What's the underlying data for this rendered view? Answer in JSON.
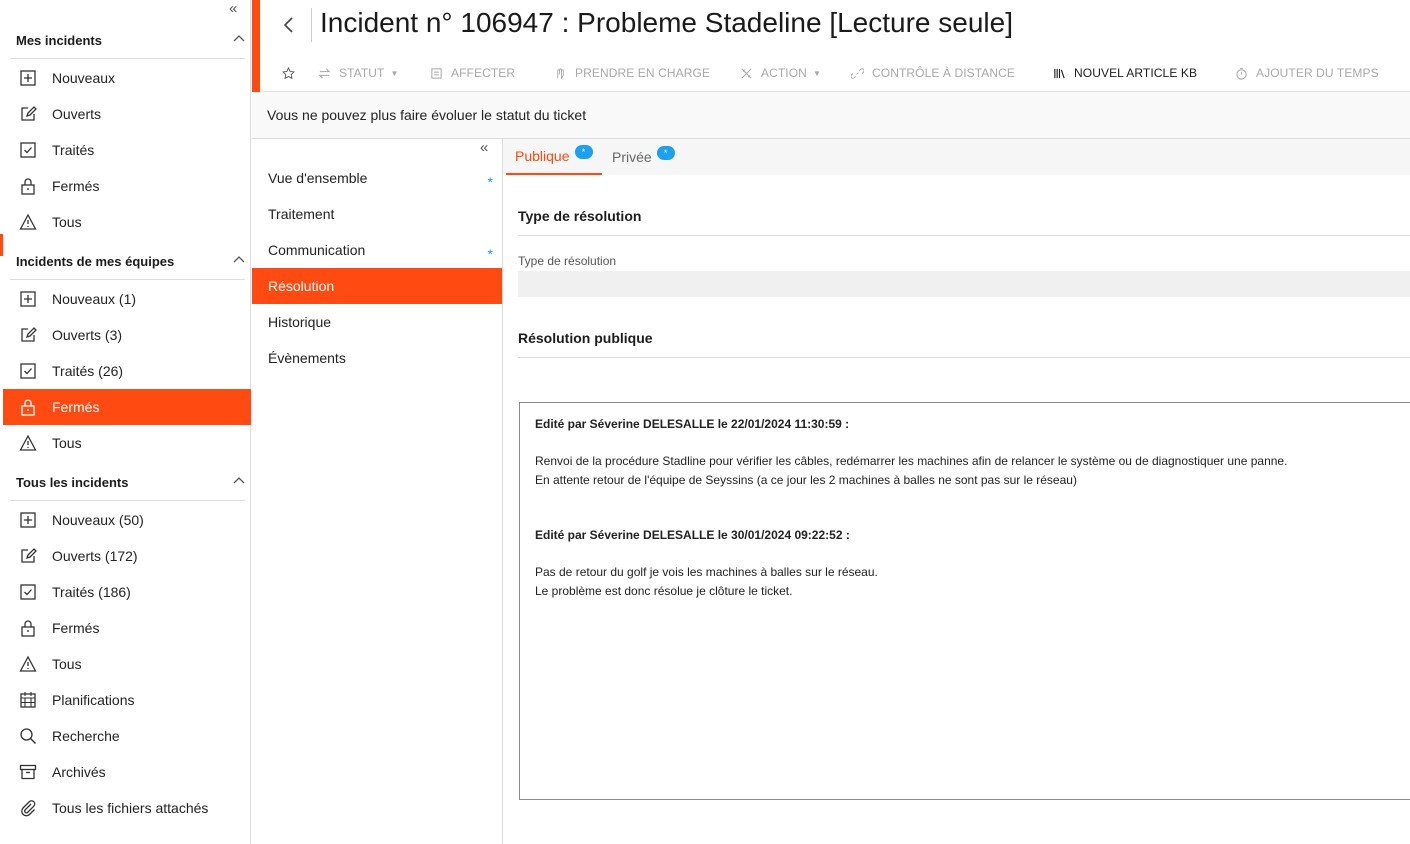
{
  "sidebar": {
    "sections": [
      {
        "title": "Mes incidents",
        "items": [
          {
            "label": "Nouveaux",
            "icon": "plus-square-icon"
          },
          {
            "label": "Ouverts",
            "icon": "edit-icon"
          },
          {
            "label": "Traités",
            "icon": "check-square-icon"
          },
          {
            "label": "Fermés",
            "icon": "lock-icon"
          },
          {
            "label": "Tous",
            "icon": "warning-icon"
          }
        ]
      },
      {
        "title": "Incidents de mes équipes",
        "items": [
          {
            "label": "Nouveaux (1)",
            "icon": "plus-square-icon"
          },
          {
            "label": "Ouverts (3)",
            "icon": "edit-icon"
          },
          {
            "label": "Traités (26)",
            "icon": "check-square-icon"
          },
          {
            "label": "Fermés",
            "icon": "lock-icon",
            "active": true
          },
          {
            "label": "Tous",
            "icon": "warning-icon"
          }
        ]
      },
      {
        "title": "Tous les incidents",
        "items": [
          {
            "label": "Nouveaux (50)",
            "icon": "plus-square-icon"
          },
          {
            "label": "Ouverts (172)",
            "icon": "edit-icon"
          },
          {
            "label": "Traités (186)",
            "icon": "check-square-icon"
          },
          {
            "label": "Fermés",
            "icon": "lock-icon"
          },
          {
            "label": "Tous",
            "icon": "warning-icon"
          },
          {
            "label": "Planifications",
            "icon": "calendar-icon"
          },
          {
            "label": "Recherche",
            "icon": "search-icon"
          },
          {
            "label": "Archivés",
            "icon": "archive-icon"
          },
          {
            "label": "Tous les fichiers attachés",
            "icon": "paperclip-icon"
          }
        ]
      }
    ]
  },
  "header": {
    "title": "Incident n° 106947 : Probleme Stadeline [Lecture seule]"
  },
  "toolbar": {
    "statut": "STATUT",
    "affecter": "AFFECTER",
    "prendre": "PRENDRE EN CHARGE",
    "action": "ACTION",
    "controle": "CONTRÔLE À DISTANCE",
    "nouvel_article": "NOUVEL ARTICLE KB",
    "ajouter_temps": "AJOUTER DU TEMPS"
  },
  "notice": "Vous ne pouvez plus faire évoluer le statut du ticket",
  "subnav": {
    "items": [
      {
        "label": "Vue d'ensemble",
        "star": true
      },
      {
        "label": "Traitement",
        "star": false
      },
      {
        "label": "Communication",
        "star": true
      },
      {
        "label": "Résolution",
        "star": false,
        "active": true
      },
      {
        "label": "Historique",
        "star": false
      },
      {
        "label": "Évènements",
        "star": false
      }
    ],
    "star_glyph": "*"
  },
  "tabs": {
    "public": "Publique",
    "private": "Privée",
    "badge": "*"
  },
  "resolution": {
    "type_section_title": "Type de résolution",
    "type_field_label": "Type de résolution",
    "type_field_value": "",
    "public_section_title": "Résolution publique",
    "entries": [
      {
        "head": "Edité par Séverine DELESALLE le 22/01/2024 11:30:59 :",
        "line1": "Renvoi de la procédure Stadline pour vérifier les câbles, redémarrer les machines afin de relancer le système ou de diagnostiquer une panne.",
        "line2": "En attente retour de l'équipe de Seyssins (a ce jour les 2 machines à balles ne sont pas sur le réseau)"
      },
      {
        "head": "Edité par Séverine DELESALLE le 30/01/2024 09:22:52 :",
        "line1": "Pas de retour du golf je vois les machines à balles sur le réseau.",
        "line2": "Le problème est donc résolue je clôture le ticket."
      }
    ]
  },
  "colors": {
    "accent": "#ff4a12",
    "badge": "#1ea0f0"
  }
}
